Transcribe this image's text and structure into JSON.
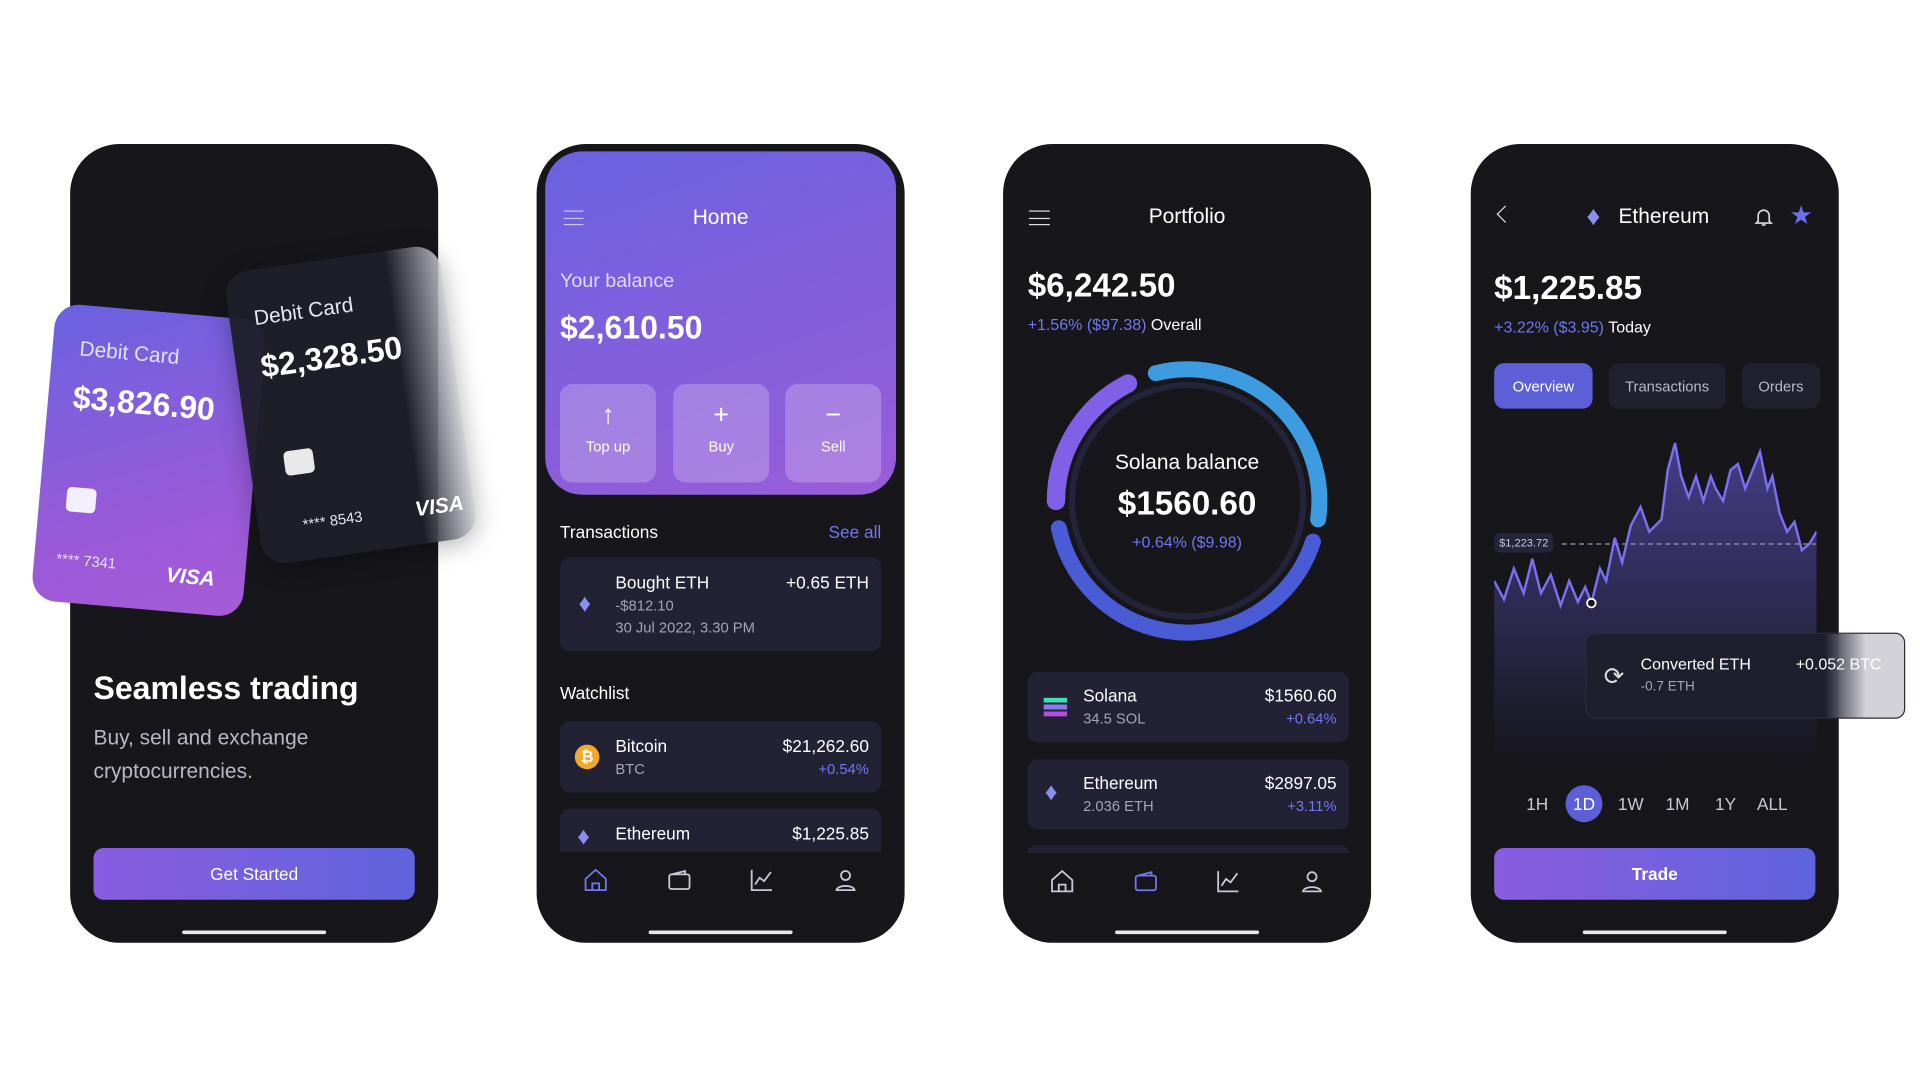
{
  "colors": {
    "accent": "#7277f2",
    "phone_bg": "#16161b",
    "card_bg": "#222234",
    "bitcoin": "#f0a92b"
  },
  "onboarding": {
    "card_front": {
      "label": "Debit Card",
      "amount": "$3,826.90",
      "number": "**** 7341",
      "brand": "VISA"
    },
    "card_back": {
      "label": "Debit Card",
      "amount": "$2,328.50",
      "number": "**** 8543",
      "brand": "VISA"
    },
    "title": "Seamless trading",
    "subtitle_line1": "Buy, sell and exchange",
    "subtitle_line2": "cryptocurrencies.",
    "cta": "Get Started"
  },
  "home": {
    "title": "Home",
    "balance_label": "Your balance",
    "balance": "$2,610.50",
    "actions": [
      {
        "icon": "arrow-up-icon",
        "glyph": "↑",
        "label": "Top up"
      },
      {
        "icon": "plus-icon",
        "glyph": "+",
        "label": "Buy"
      },
      {
        "icon": "minus-icon",
        "glyph": "−",
        "label": "Sell"
      }
    ],
    "transactions_label": "Transactions",
    "see_all": "See all",
    "transaction": {
      "title": "Bought ETH",
      "amount": "-$812.10",
      "date": "30 Jul 2022, 3.30 PM",
      "change": "+0.65 ETH"
    },
    "watchlist_label": "Watchlist",
    "watchlist": [
      {
        "name": "Bitcoin",
        "symbol": "BTC",
        "price": "$21,262.60",
        "change": "+0.54%"
      },
      {
        "name": "Ethereum",
        "price": "$1,225.85"
      }
    ]
  },
  "portfolio": {
    "title": "Portfolio",
    "total": "$6,242.50",
    "change": "+1.56% ($97.38)",
    "change_suffix": "Overall",
    "ring": {
      "label": "Solana balance",
      "value": "$1560.60",
      "change": "+0.64% ($9.98)"
    },
    "assets": [
      {
        "name": "Solana",
        "amount": "34.5 SOL",
        "value": "$1560.60",
        "change": "+0.64%"
      },
      {
        "name": "Ethereum",
        "amount": "2.036 ETH",
        "value": "$2897.05",
        "change": "+3.11%"
      }
    ]
  },
  "detail": {
    "title": "Ethereum",
    "price": "$1,225.85",
    "change": "+3.22% ($3.95)",
    "change_suffix": "Today",
    "tabs": [
      "Overview",
      "Transactions",
      "Orders"
    ],
    "reference_price": "$1,223.72",
    "tooltip": {
      "title": "Converted ETH",
      "sub": "-0.7 ETH",
      "value": "+0.052 BTC"
    },
    "timeframes": [
      "1H",
      "1D",
      "1W",
      "1M",
      "1Y",
      "ALL"
    ],
    "selected_timeframe": "1D",
    "trade": "Trade"
  }
}
